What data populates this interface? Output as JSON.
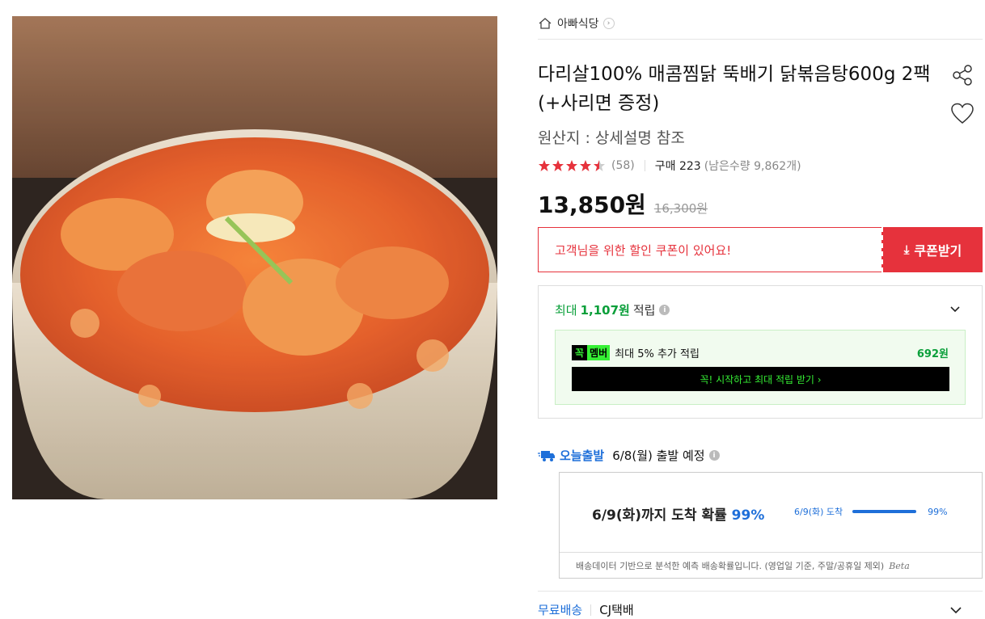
{
  "store": {
    "name": "아빠식당"
  },
  "product": {
    "title": "다리살100% 매콤찜닭 뚝배기 닭볶음탕600g 2팩(+사리면 증정)",
    "origin": "원산지 : 상세설명 참조",
    "rating": 4.5,
    "review_count": "(58)",
    "purchase": "구매 223",
    "remaining": "(남은수량 9,862개)",
    "price": "13,850원",
    "original_price": "16,300원"
  },
  "coupon": {
    "message": "고객님을 위한 할인 쿠폰이 있어요!",
    "button": "쿠폰받기"
  },
  "points": {
    "prefix": "최대",
    "amount": "1,107원",
    "suffix": "적립",
    "member_badge_a": "꼭",
    "member_badge_b": "멤버",
    "member_text": "최대 5% 추가 적립",
    "member_amount": "692원",
    "member_button": "꼭! 시작하고 최대 적립 받기 ›"
  },
  "shipping": {
    "badge": "오늘출발",
    "schedule": "6/8(월) 출발 예정",
    "predict_prefix": "6/9(화)까지 도착 확률",
    "predict_pct": "99%",
    "graph_label": "6/9(화) 도착",
    "graph_pct": "99%",
    "graph_fraction": 0.99,
    "footnote": "배송데이터 기반으로 분석한 예측 배송확률입니다. (영업일 기준, 주말/공휴일 제외)",
    "beta": "Beta",
    "free": "무료배송",
    "carrier": "CJ택배"
  },
  "colors": {
    "accent_red": "#e6323c",
    "points_green": "#0a9f3a",
    "member_lime": "#36f135",
    "delivery_blue": "#1e6fd9"
  }
}
